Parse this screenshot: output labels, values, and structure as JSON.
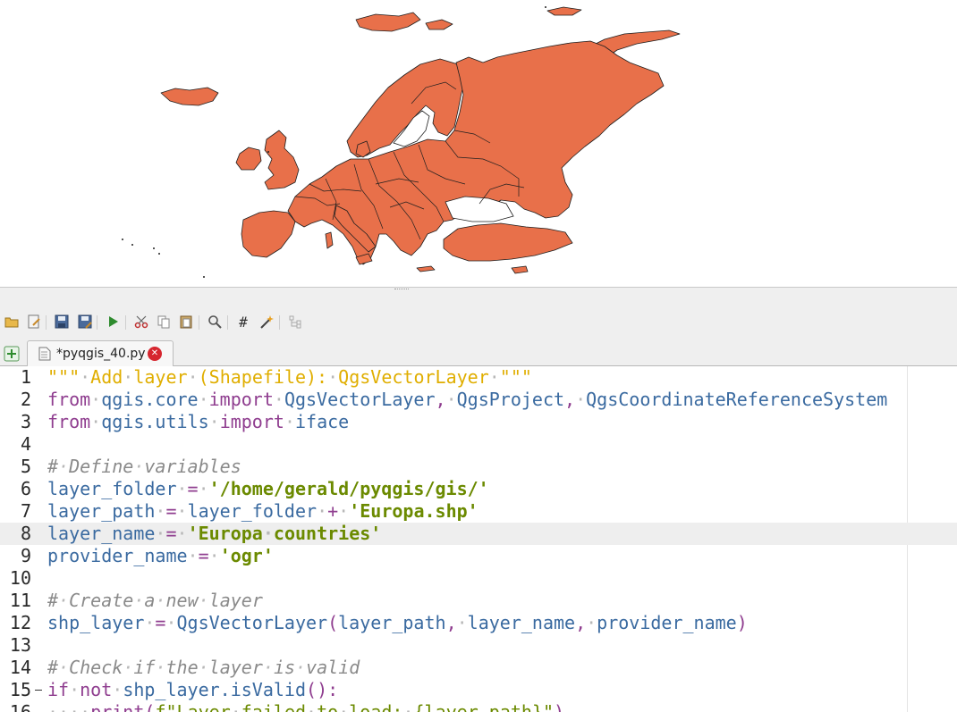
{
  "map": {
    "layer_name": "Europa countries",
    "fill_color": "#e8704a",
    "stroke_color": "#1f1f1f"
  },
  "toolbar": {
    "buttons": [
      {
        "name": "open-script-icon"
      },
      {
        "name": "open-in-external-editor-icon"
      },
      {
        "name": "save-icon"
      },
      {
        "name": "save-as-icon"
      },
      {
        "name": "run-script-icon"
      },
      {
        "name": "cut-icon"
      },
      {
        "name": "copy-icon"
      },
      {
        "name": "paste-icon"
      },
      {
        "name": "find-icon"
      },
      {
        "name": "comment-icon",
        "glyph": "#"
      },
      {
        "name": "reformat-code-icon"
      },
      {
        "name": "object-inspector-icon"
      }
    ]
  },
  "tabs": [
    {
      "label": "*pyqgis_40.py",
      "active": true
    }
  ],
  "editor": {
    "current_line": 8,
    "lines": [
      {
        "n": "1",
        "text": "\"\"\" Add layer (Shapefile): QgsVectorLayer \"\"\""
      },
      {
        "n": "2",
        "text": "from qgis.core import QgsVectorLayer, QgsProject, QgsCoordinateReferenceSystem"
      },
      {
        "n": "3",
        "text": "from qgis.utils import iface"
      },
      {
        "n": "4",
        "text": ""
      },
      {
        "n": "5",
        "text": "# Define variables"
      },
      {
        "n": "6",
        "text": "layer_folder = '/home/gerald/pyqgis/gis/'"
      },
      {
        "n": "7",
        "text": "layer_path = layer_folder + 'Europa.shp'"
      },
      {
        "n": "8",
        "text": "layer_name = 'Europa countries'"
      },
      {
        "n": "9",
        "text": "provider_name = 'ogr'"
      },
      {
        "n": "10",
        "text": ""
      },
      {
        "n": "11",
        "text": "# Create a new layer"
      },
      {
        "n": "12",
        "text": "shp_layer = QgsVectorLayer(layer_path, layer_name, provider_name)"
      },
      {
        "n": "13",
        "text": ""
      },
      {
        "n": "14",
        "text": "# Check if the layer is valid"
      },
      {
        "n": "15",
        "text": "if not shp_layer.isValid():"
      },
      {
        "n": "16",
        "text": "    print(f\"Layer failed to load: {layer_path}\")"
      }
    ]
  }
}
